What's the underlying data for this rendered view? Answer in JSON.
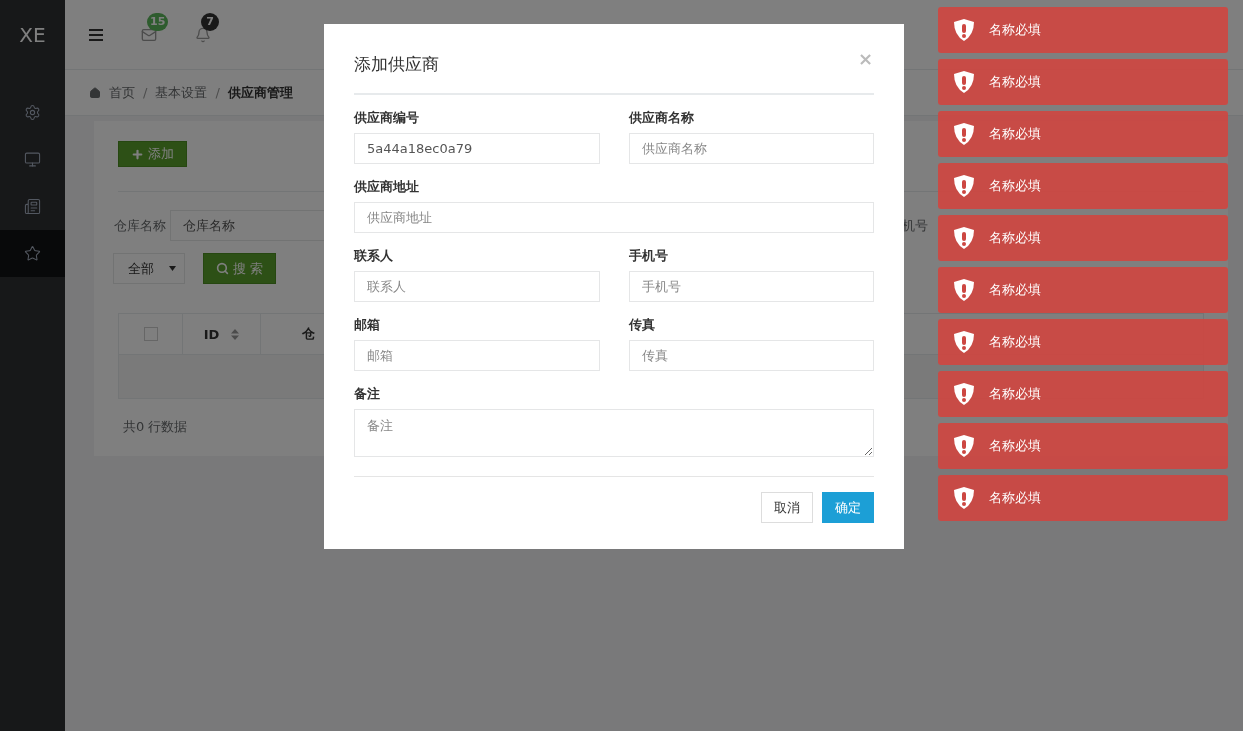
{
  "topbar": {
    "logo": "XE",
    "mail_badge": "15",
    "alerts_badge": "7"
  },
  "sidebar": {
    "items": [
      {
        "selected": false
      },
      {
        "selected": false
      },
      {
        "selected": false
      },
      {
        "selected": true
      }
    ]
  },
  "breadcrumb": [
    {
      "label": "首页",
      "separator": "/",
      "current": false
    },
    {
      "label": "基本设置",
      "separator": "/",
      "current": false
    },
    {
      "label": "供应商管理",
      "current": true
    }
  ],
  "toolbar": {
    "add_button": "添加"
  },
  "filters": {
    "label": "仓库名称",
    "placeholder": "仓库名称",
    "right_label": "机号",
    "status_select": "全部",
    "search_button": "搜 索"
  },
  "table": {
    "header_checkbox": {
      "checked": false
    },
    "columns": [
      {
        "label": "ID",
        "sortable": true
      },
      {
        "label": "仓",
        "sortable": false
      }
    ],
    "footer": "共0 行数据"
  },
  "modal": {
    "title": "添加供应商",
    "close": "×",
    "rows": [
      [
        {
          "label": "供应商编号",
          "value": "5a44a18ec0a79",
          "kind": "input"
        },
        {
          "label": "供应商名称",
          "placeholder": "供应商名称",
          "kind": "input"
        }
      ],
      [
        {
          "label": "供应商地址",
          "placeholder": "供应商地址",
          "kind": "input"
        }
      ],
      [
        {
          "label": "联系人",
          "placeholder": "联系人",
          "kind": "input"
        },
        {
          "label": "手机号",
          "placeholder": "手机号",
          "kind": "input"
        }
      ],
      [
        {
          "label": "邮箱",
          "placeholder": "邮箱",
          "kind": "input"
        },
        {
          "label": "传真",
          "placeholder": "传真",
          "kind": "input"
        }
      ],
      [
        {
          "label": "备注",
          "placeholder": "备注",
          "kind": "textarea"
        }
      ]
    ],
    "buttons": [
      {
        "label": "取消",
        "primary": false
      },
      {
        "label": "确定",
        "primary": true
      }
    ]
  },
  "toasts": [
    {
      "message": "名称必填"
    },
    {
      "message": "名称必填"
    },
    {
      "message": "名称必填"
    },
    {
      "message": "名称必填"
    },
    {
      "message": "名称必填"
    },
    {
      "message": "名称必填"
    },
    {
      "message": "名称必填"
    },
    {
      "message": "名称必填"
    },
    {
      "message": "名称必填"
    },
    {
      "message": "名称必填"
    }
  ]
}
